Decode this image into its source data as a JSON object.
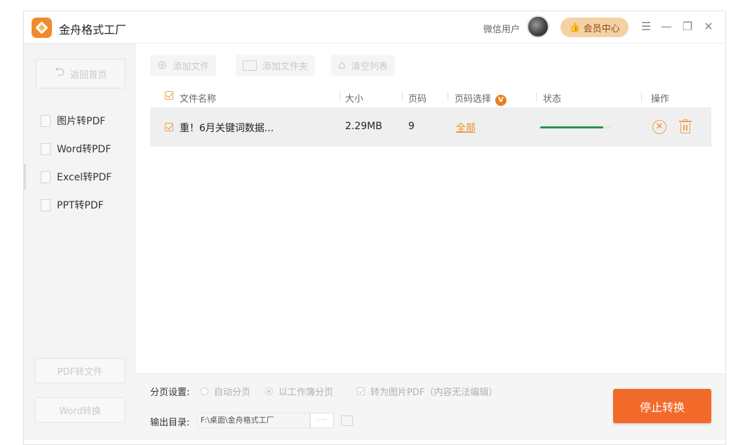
{
  "titlebar": {
    "app_title": "金舟格式工厂",
    "wechat_user": "微信用户",
    "member_center": "会员中心"
  },
  "sidebar": {
    "back_home": "返回首页",
    "items": [
      {
        "label": "图片转PDF"
      },
      {
        "label": "Word转PDF"
      },
      {
        "label": "Excel转PDF"
      },
      {
        "label": "PPT转PDF"
      }
    ],
    "bottom_buttons": [
      "PDF转文件",
      "Word转换"
    ]
  },
  "toolbar": {
    "add_file": "添加文件",
    "add_folder": "添加文件夹",
    "clear_list": "清空列表"
  },
  "table": {
    "headers": {
      "name": "文件名称",
      "size": "大小",
      "pages": "页码",
      "page_select": "页码选择",
      "status": "状态",
      "actions": "操作"
    },
    "vip_badge": "V",
    "rows": [
      {
        "name": "重！6月关键词数据...",
        "size": "2.29MB",
        "pages": "9",
        "page_select": "全部",
        "progress": 0.9
      }
    ]
  },
  "settings": {
    "paging_label": "分页设置:",
    "auto_paging": "自动分页",
    "sheet_paging": "以工作簿分页",
    "to_image_pdf": "转为图片PDF（内容无法编辑）",
    "output_label": "输出目录:",
    "output_path": "F:\\桌面\\金舟格式工厂",
    "browse": "···",
    "stop_convert": "停止转换"
  },
  "colors": {
    "accent": "#f26a2a",
    "progress": "#27944a",
    "link": "#e9901e"
  }
}
